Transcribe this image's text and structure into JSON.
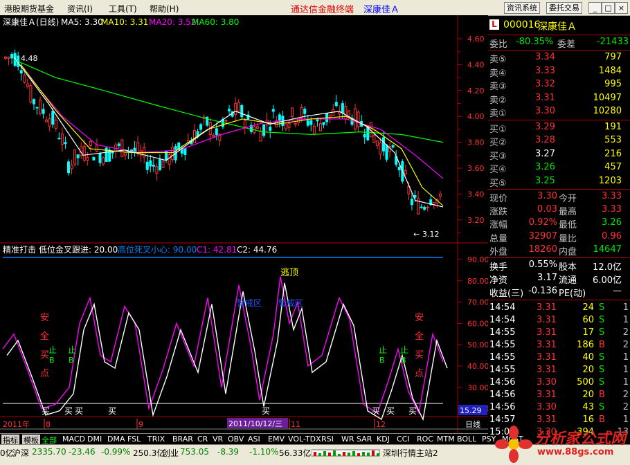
{
  "menu": {
    "items": [
      "港股期货基金",
      "资讯(I)",
      "工具(T)",
      "帮助(H)"
    ],
    "brand": "通达信金融终端",
    "stock_title": "深康佳Ａ",
    "buttons": [
      "资讯系统",
      "委托交易"
    ],
    "win": [
      "_",
      "□",
      "×"
    ]
  },
  "chart_header": {
    "name": "深康佳Ａ(日线)",
    "ma5": "MA5: 3.30",
    "ma10": "MA10: 3.31",
    "ma20": "MA20: 3.52",
    "ma60": "MA60: 3.80"
  },
  "indicator_header": {
    "name": "精准打击",
    "p1": "低位金叉跟进: 20.00",
    "p2": "高位死叉小心: 90.00",
    "c1": "C1: 42.81",
    "c2": "C2: 44.76"
  },
  "price_axis": [
    "4.60",
    "4.40",
    "4.20",
    "4.00",
    "3.80",
    "3.60",
    "3.40",
    "3.20"
  ],
  "ind_axis": [
    "90.00",
    "80.00",
    "70.00",
    "60.00",
    "50.00",
    "40.00",
    "30.00",
    "20.00"
  ],
  "ind_current": "15.29",
  "annotations": {
    "high": "4.48",
    "low": "3.12",
    "top_sign": "逃顶",
    "zone": "警戒区",
    "safe": [
      "安",
      "全",
      "买",
      "点"
    ],
    "stop": [
      "止",
      "B"
    ],
    "buy": "买"
  },
  "date_axis": {
    "labels": [
      "2011年",
      "8",
      "9",
      "11",
      "12"
    ],
    "cursor": "2011/10/12/三",
    "period": "日线"
  },
  "quote": {
    "code": "000016",
    "name": "深康佳Ａ",
    "wb_label": "委比",
    "wb": "-80.35%",
    "wc_label": "委差",
    "wc": "-21433",
    "asks": [
      {
        "label": "卖⑤",
        "price": "3.34",
        "vol": "797"
      },
      {
        "label": "卖④",
        "price": "3.33",
        "vol": "1484"
      },
      {
        "label": "卖③",
        "price": "3.32",
        "vol": "995"
      },
      {
        "label": "卖②",
        "price": "3.31",
        "vol": "10497"
      },
      {
        "label": "卖①",
        "price": "3.30",
        "vol": "10280"
      }
    ],
    "bids": [
      {
        "label": "买①",
        "price": "3.29",
        "vol": "191"
      },
      {
        "label": "买②",
        "price": "3.28",
        "vol": "553"
      },
      {
        "label": "买③",
        "price": "3.27",
        "vol": "216"
      },
      {
        "label": "买④",
        "price": "3.26",
        "vol": "457"
      },
      {
        "label": "买⑤",
        "price": "3.25",
        "vol": "1203"
      }
    ],
    "stats": [
      {
        "l1": "现价",
        "v1": "3.30",
        "l2": "今开",
        "v2": "3.33"
      },
      {
        "l1": "涨跌",
        "v1": "0.03",
        "l2": "最高",
        "v2": "3.33"
      },
      {
        "l1": "涨幅",
        "v1": "0.92%",
        "l2": "最低",
        "v2": "3.26"
      },
      {
        "l1": "总量",
        "v1": "32907",
        "l2": "量比",
        "v2": "0.96"
      },
      {
        "l1": "外盘",
        "v1": "18260",
        "l2": "内盘",
        "v2": "14647"
      }
    ],
    "stats2": [
      {
        "l1": "换手",
        "v1": "0.55%",
        "l2": "股本",
        "v2": "12.0亿"
      },
      {
        "l1": "净资",
        "v1": "3.17",
        "l2": "流通",
        "v2": "6.00亿"
      },
      {
        "l1": "收益(三)",
        "v1": "-0.136",
        "l2": "PE(动)",
        "v2": "—"
      }
    ],
    "trades": [
      {
        "time": "14:54",
        "price": "3.31",
        "vol": "24",
        "bs": "S",
        "n": "1"
      },
      {
        "time": "14:54",
        "price": "3.31",
        "vol": "60",
        "bs": "S",
        "n": "1"
      },
      {
        "time": "14:55",
        "price": "3.31",
        "vol": "17",
        "bs": "S",
        "n": "2"
      },
      {
        "time": "14:55",
        "price": "3.31",
        "vol": "186",
        "bs": "B",
        "n": "2"
      },
      {
        "time": "14:55",
        "price": "3.31",
        "vol": "40",
        "bs": "S",
        "n": "1"
      },
      {
        "time": "14:55",
        "price": "3.31",
        "vol": "20",
        "bs": "S",
        "n": "1"
      },
      {
        "time": "14:56",
        "price": "3.30",
        "vol": "500",
        "bs": "S",
        "n": "1"
      },
      {
        "time": "14:56",
        "price": "3.31",
        "vol": "20",
        "bs": "B",
        "n": "2"
      },
      {
        "time": "14:56",
        "price": "3.30",
        "vol": "43",
        "bs": "S",
        "n": "2"
      },
      {
        "time": "14:57",
        "price": "3.31",
        "vol": "16",
        "bs": "B",
        "n": "1"
      },
      {
        "time": "15:00",
        "price": "3.30",
        "vol": "394",
        "bs": "",
        "n": "13"
      }
    ]
  },
  "tabs": [
    "指标",
    "模板",
    "全部",
    "MACD",
    "DMI",
    "DMA",
    "FSL",
    "TRIX",
    "BRAR",
    "CR",
    "VR",
    "OBV",
    "ASI",
    "EMV",
    "VOL-TDX",
    "RSI",
    "WR",
    "SAR",
    "KDJ",
    "CCI",
    "ROC",
    "MTM",
    "BOLL",
    "PSY",
    "MCST"
  ],
  "status": {
    "s0": "0亿",
    "sh_label": "沪深",
    "sh_val": "2335.70",
    "sh_chg": "-23.46",
    "sh_pct": "-0.99%",
    "sh_amt": "250.3亿",
    "cy_label": "创业",
    "cy_val": "753.05",
    "cy_chg": "-8.39",
    "cy_pct": "-1.10%",
    "cy_amt": "56.33亿",
    "server": "深圳行情主站2"
  },
  "watermark": {
    "title": "分析家公式网",
    "url": "www.88gs.com"
  },
  "colors": {
    "up": "#ff3232",
    "down": "#00ffff",
    "ma5": "#ffffff",
    "ma10": "#ffff00",
    "ma20": "#ff00ff",
    "ma60": "#00ff00",
    "grid": "#b00000"
  }
}
